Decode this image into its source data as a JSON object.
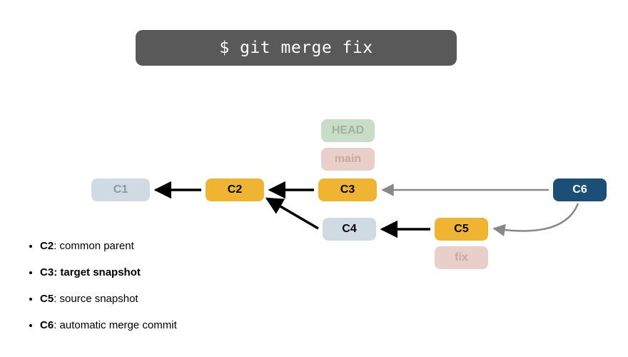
{
  "command": "$ git merge fix",
  "refs": {
    "head": "HEAD",
    "main": "main",
    "fix": "fix"
  },
  "commits": {
    "c1": "C1",
    "c2": "C2",
    "c3": "C3",
    "c4": "C4",
    "c5": "C5",
    "c6": "C6"
  },
  "legend": {
    "c2": {
      "label": "C2",
      "desc": ": common parent",
      "bold": false
    },
    "c3": {
      "label": "C3",
      "desc": ": target snapshot",
      "bold": true
    },
    "c5": {
      "label": "C5",
      "desc": ": source snapshot",
      "bold": false
    },
    "c6": {
      "label": "C6",
      "desc": ": automatic merge commit",
      "bold": false
    }
  },
  "arrows": [
    {
      "from": "C2",
      "to": "C1",
      "type": "solid"
    },
    {
      "from": "C3",
      "to": "C2",
      "type": "solid"
    },
    {
      "from": "C4",
      "to": "C2",
      "type": "solid"
    },
    {
      "from": "C5",
      "to": "C4",
      "type": "solid"
    },
    {
      "from": "C6",
      "to": "C3",
      "type": "dashed"
    },
    {
      "from": "C6",
      "to": "C5",
      "type": "dashed"
    }
  ]
}
